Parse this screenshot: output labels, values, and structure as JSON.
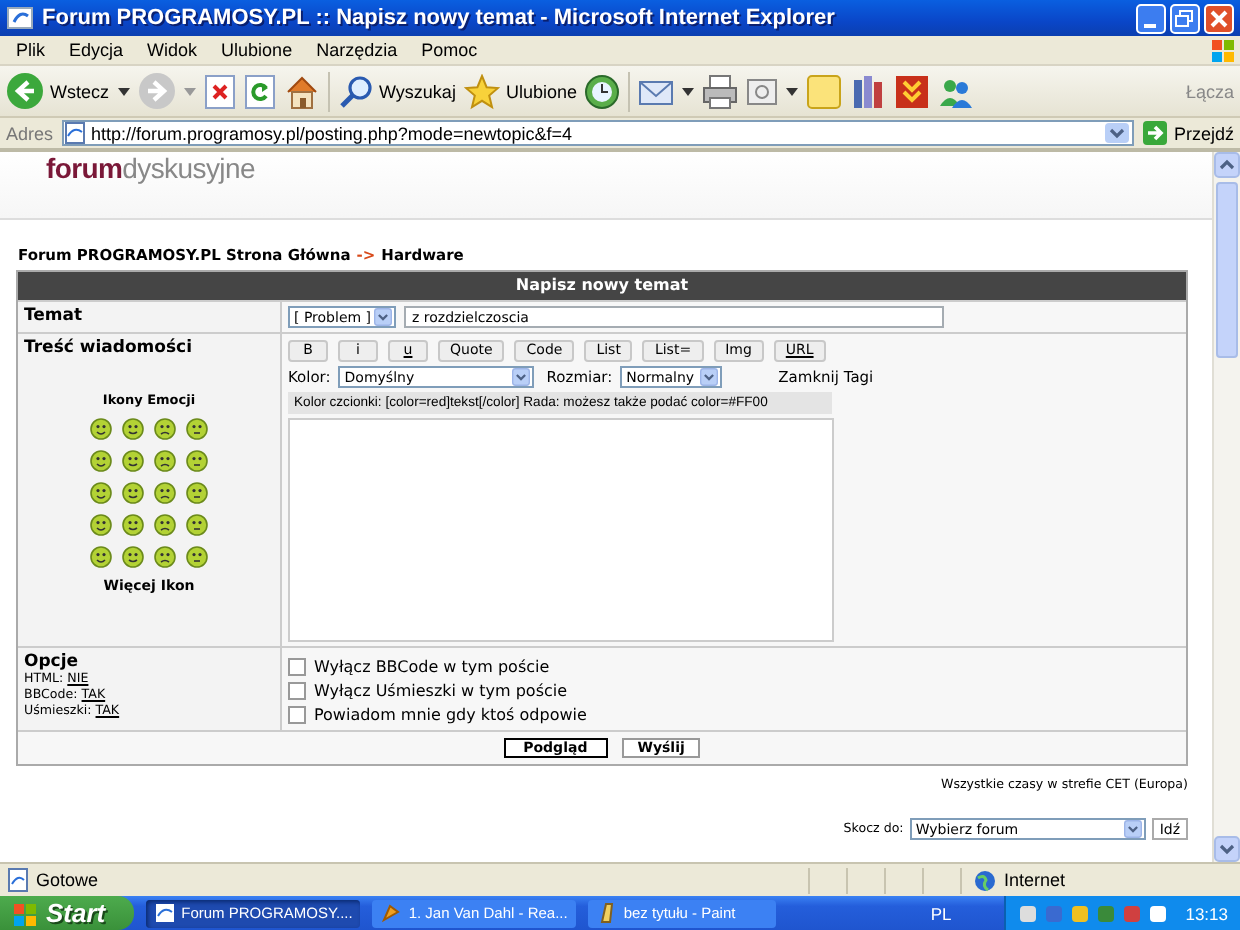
{
  "window": {
    "title": "Forum PROGRAMOSY.PL :: Napisz nowy temat - Microsoft Internet Explorer"
  },
  "menu": [
    "Plik",
    "Edycja",
    "Widok",
    "Ulubione",
    "Narzędzia",
    "Pomoc"
  ],
  "toolbar": {
    "back": "Wstecz",
    "search": "Wyszukaj",
    "favorites": "Ulubione",
    "links": "Łącza"
  },
  "address_bar": {
    "label": "Adres",
    "url": "http://forum.programosy.pl/posting.php?mode=newtopic&f=4",
    "go": "Przejdź"
  },
  "logo": {
    "bold": "forum",
    "light": "dyskusyjne"
  },
  "breadcrumb": {
    "home": "Forum PROGRAMOSY.PL Strona Główna",
    "separator": "->",
    "current": "Hardware"
  },
  "form": {
    "heading": "Napisz nowy temat",
    "subject": {
      "label": "Temat",
      "prefix": "[ Problem ]",
      "value": "z rozdzielczoscia"
    },
    "message": {
      "label": "Treść wiadomości",
      "emoticons_title": "Ikony Emocji",
      "more_emoticons": "Więcej Ikon",
      "format_buttons": [
        {
          "label": "B",
          "kind": "bold"
        },
        {
          "label": "i",
          "kind": "italic"
        },
        {
          "label": "u",
          "kind": "underline"
        },
        {
          "label": "Quote",
          "kind": "plain"
        },
        {
          "label": "Code",
          "kind": "plain"
        },
        {
          "label": "List",
          "kind": "plain"
        },
        {
          "label": "List=",
          "kind": "plain"
        },
        {
          "label": "Img",
          "kind": "plain"
        },
        {
          "label": "URL",
          "kind": "underline"
        }
      ],
      "color_label": "Kolor:",
      "color_value": "Domyślny",
      "size_label": "Rozmiar:",
      "size_value": "Normalny",
      "close_tags": "Zamknij Tagi",
      "help": "Kolor czcionki: [color=red]tekst[/color]  Rada: możesz także podać color=#FF00"
    },
    "options": {
      "label": "Opcje",
      "settings": [
        {
          "name": "HTML:",
          "value": "NIE"
        },
        {
          "name": "BBCode:",
          "value": "TAK"
        },
        {
          "name": "Uśmieszki:",
          "value": "TAK"
        }
      ],
      "checkboxes": [
        {
          "label": "Wyłącz BBCode w tym poście",
          "checked": false
        },
        {
          "label": "Wyłącz Uśmieszki w tym poście",
          "checked": false
        },
        {
          "label": "Powiadom mnie gdy ktoś odpowie",
          "checked": false
        }
      ]
    },
    "buttons": [
      {
        "label": "Podgląd",
        "default": true
      },
      {
        "label": "Wyślij",
        "default": false
      }
    ]
  },
  "timezone": "Wszystkie czasy w strefie CET (Europa)",
  "jump": {
    "label": "Skocz do:",
    "value": "Wybierz forum",
    "button": "Idź"
  },
  "status_bar": {
    "text": "Gotowe",
    "zone": "Internet"
  },
  "taskbar": {
    "start": "Start",
    "tasks": [
      {
        "label": "Forum PROGRAMOSY....",
        "selected": true
      },
      {
        "label": "1. Jan Van Dahl - Rea...",
        "selected": false
      },
      {
        "label": "bez tytułu - Paint",
        "selected": false
      }
    ],
    "language": "PL",
    "clock": "13:13"
  }
}
